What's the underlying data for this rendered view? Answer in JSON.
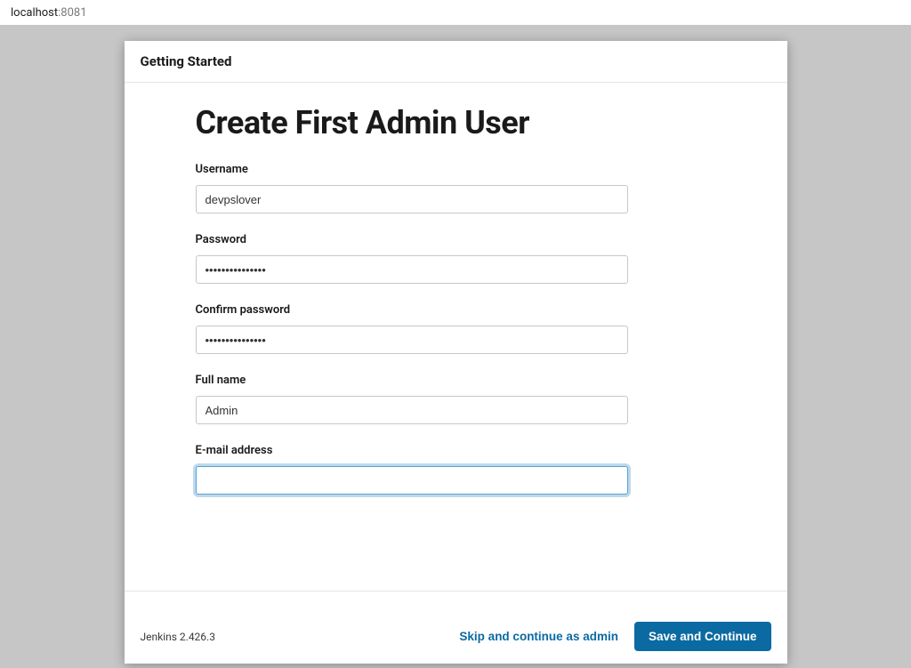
{
  "address": {
    "host": "localhost",
    "port": ":8081"
  },
  "wizard": {
    "header": "Getting Started",
    "title": "Create First Admin User"
  },
  "form": {
    "username": {
      "label": "Username",
      "value": "devpslover"
    },
    "password": {
      "label": "Password",
      "value": "•••••••••••••••"
    },
    "confirm_password": {
      "label": "Confirm password",
      "value": "•••••••••••••••"
    },
    "full_name": {
      "label": "Full name",
      "value": "Admin"
    },
    "email": {
      "label": "E-mail address",
      "value": ""
    }
  },
  "footer": {
    "version": "Jenkins 2.426.3",
    "skip_label": "Skip and continue as admin",
    "save_label": "Save and Continue"
  }
}
